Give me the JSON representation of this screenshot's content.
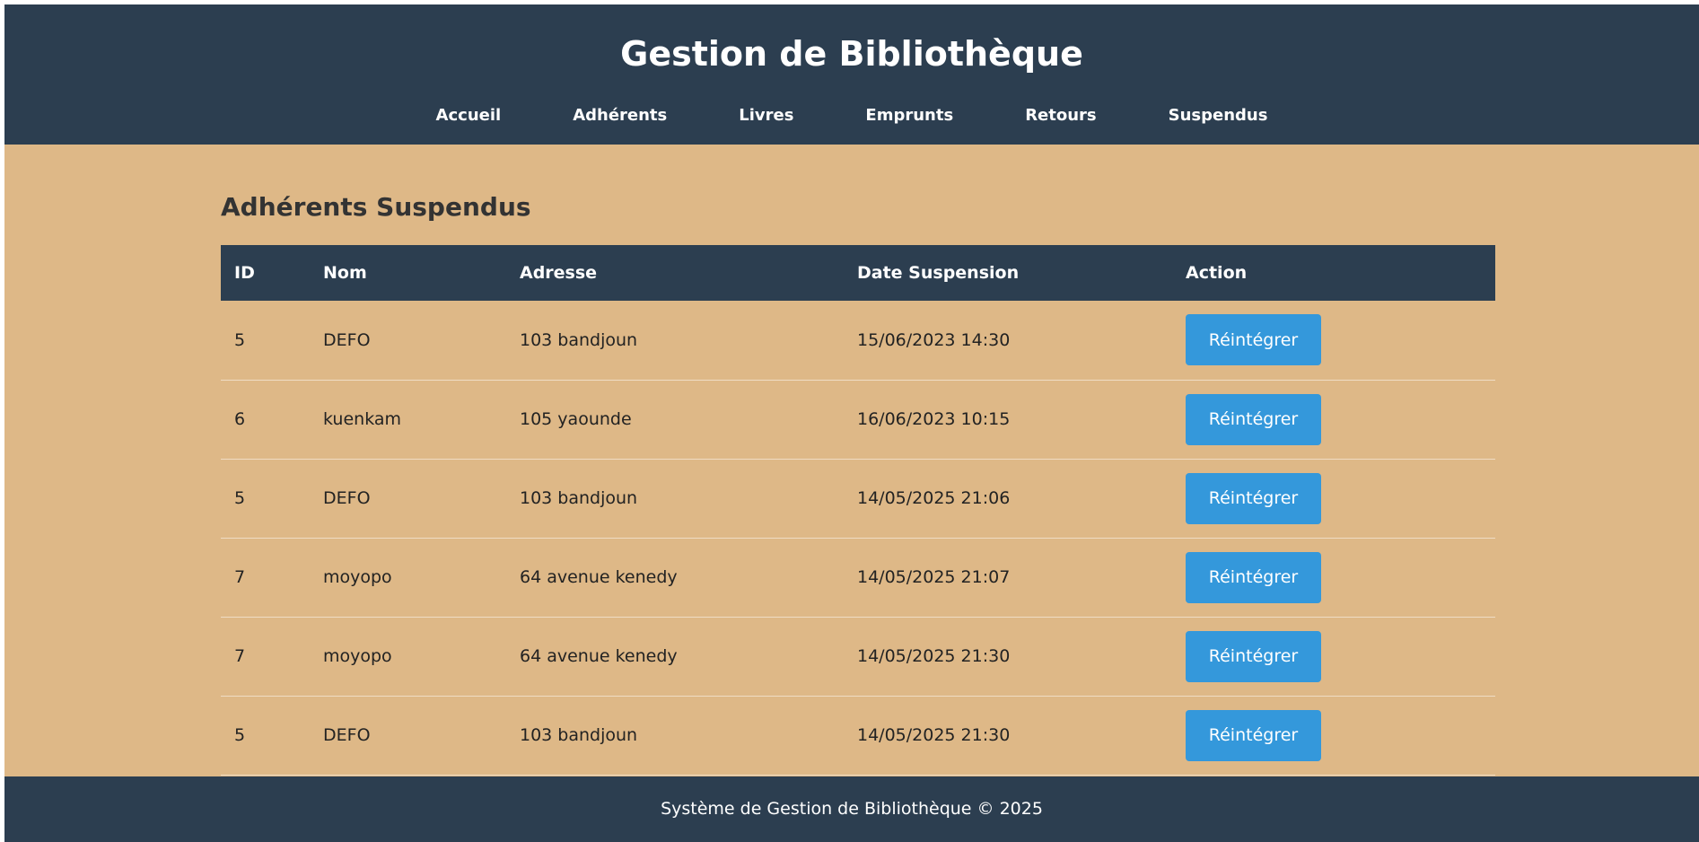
{
  "header": {
    "title": "Gestion de Bibliothèque",
    "nav": [
      "Accueil",
      "Adhérents",
      "Livres",
      "Emprunts",
      "Retours",
      "Suspendus"
    ]
  },
  "main": {
    "heading": "Adhérents Suspendus",
    "columns": [
      "ID",
      "Nom",
      "Adresse",
      "Date Suspension",
      "Action"
    ],
    "rows": [
      {
        "id": "5",
        "nom": "DEFO",
        "adresse": "103 bandjoun",
        "date": "15/06/2023 14:30",
        "action": "Réintégrer"
      },
      {
        "id": "6",
        "nom": "kuenkam",
        "adresse": "105 yaounde",
        "date": "16/06/2023 10:15",
        "action": "Réintégrer"
      },
      {
        "id": "5",
        "nom": "DEFO",
        "adresse": "103 bandjoun",
        "date": "14/05/2025 21:06",
        "action": "Réintégrer"
      },
      {
        "id": "7",
        "nom": "moyopo",
        "adresse": "64 avenue kenedy",
        "date": "14/05/2025 21:07",
        "action": "Réintégrer"
      },
      {
        "id": "7",
        "nom": "moyopo",
        "adresse": "64 avenue kenedy",
        "date": "14/05/2025 21:30",
        "action": "Réintégrer"
      },
      {
        "id": "5",
        "nom": "DEFO",
        "adresse": "103 bandjoun",
        "date": "14/05/2025 21:30",
        "action": "Réintégrer"
      }
    ]
  },
  "footer": {
    "text": "Système de Gestion de Bibliothèque © 2025"
  },
  "colors": {
    "header_bg": "#2c3e50",
    "page_bg": "#deb887",
    "button_bg": "#3498db"
  }
}
